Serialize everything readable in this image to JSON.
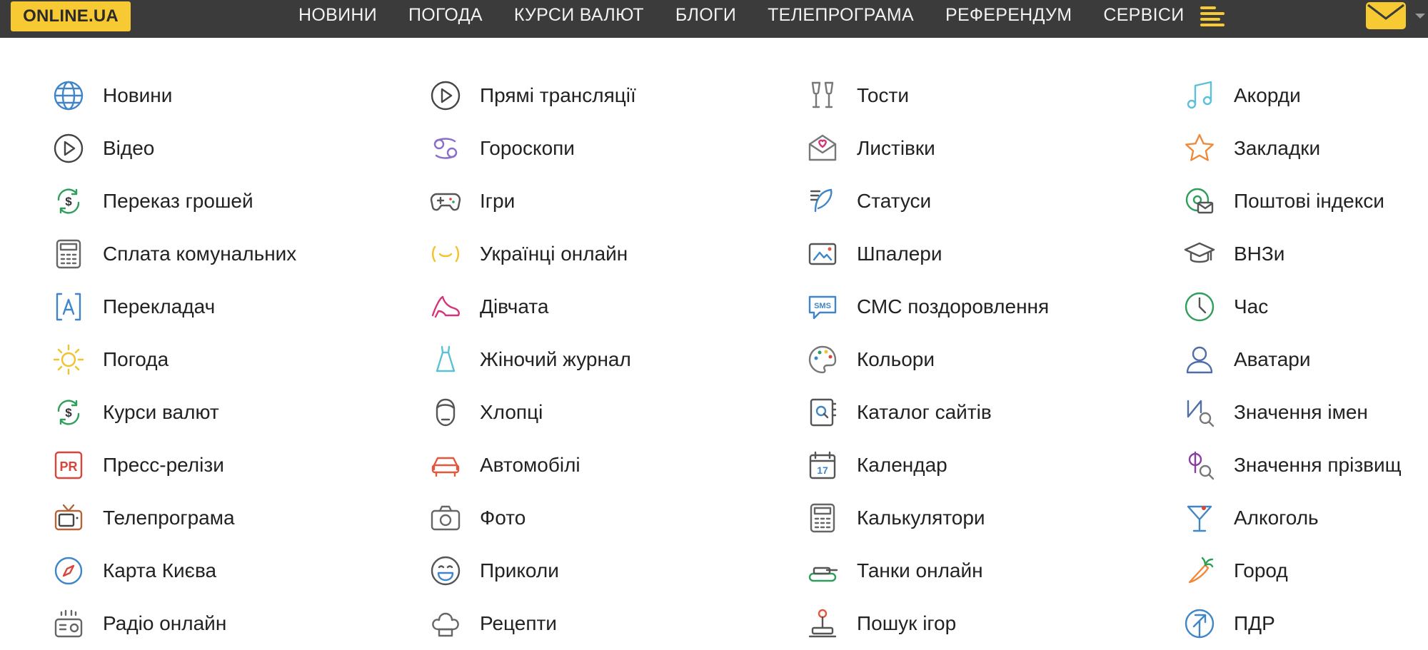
{
  "header": {
    "logo": "ONLINE.UA",
    "nav": [
      "НОВИНИ",
      "ПОГОДА",
      "КУРСИ ВАЛЮТ",
      "БЛОГИ",
      "ТЕЛЕПРОГРАМА",
      "РЕФЕРЕНДУМ",
      "СЕРВІСИ"
    ],
    "icons": {
      "menu": "menu-icon",
      "mail": "mail-icon"
    },
    "colors": {
      "bar": "#3b3b3b",
      "accent": "#f7c933"
    }
  },
  "columns": [
    [
      {
        "label": "Новини",
        "icon": "globe-icon"
      },
      {
        "label": "Відео",
        "icon": "play-icon"
      },
      {
        "label": "Переказ грошей",
        "icon": "money-transfer-icon"
      },
      {
        "label": "Сплата комунальних",
        "icon": "calculator-icon"
      },
      {
        "label": "Перекладач",
        "icon": "translate-icon"
      },
      {
        "label": "Погода",
        "icon": "sun-icon"
      },
      {
        "label": "Курси валют",
        "icon": "currency-icon"
      },
      {
        "label": "Пресс-релізи",
        "icon": "pr-icon"
      },
      {
        "label": "Телепрограма",
        "icon": "tv-icon"
      },
      {
        "label": "Карта Києва",
        "icon": "compass-icon"
      },
      {
        "label": "Радіо онлайн",
        "icon": "radio-icon"
      }
    ],
    [
      {
        "label": "Прямі трансляції",
        "icon": "play-icon"
      },
      {
        "label": "Гороскопи",
        "icon": "horoscope-icon"
      },
      {
        "label": "Ігри",
        "icon": "gamepad-icon"
      },
      {
        "label": "Українці онлайн",
        "icon": "smile-icon"
      },
      {
        "label": "Дівчата",
        "icon": "high-heel-icon"
      },
      {
        "label": "Жіночий журнал",
        "icon": "dress-icon"
      },
      {
        "label": "Хлопці",
        "icon": "man-face-icon"
      },
      {
        "label": "Автомобілі",
        "icon": "car-icon"
      },
      {
        "label": "Фото",
        "icon": "camera-icon"
      },
      {
        "label": "Приколи",
        "icon": "laugh-icon"
      },
      {
        "label": "Рецепти",
        "icon": "chef-hat-icon"
      }
    ],
    [
      {
        "label": "Тости",
        "icon": "glasses-icon"
      },
      {
        "label": "Листівки",
        "icon": "postcard-icon"
      },
      {
        "label": "Статуси",
        "icon": "feather-icon"
      },
      {
        "label": "Шпалери",
        "icon": "wallpaper-icon"
      },
      {
        "label": "СМС поздоровлення",
        "icon": "sms-icon"
      },
      {
        "label": "Кольори",
        "icon": "palette-icon"
      },
      {
        "label": "Каталог сайтів",
        "icon": "catalog-icon"
      },
      {
        "label": "Календар",
        "icon": "calendar-icon"
      },
      {
        "label": "Калькулятори",
        "icon": "calculator-icon"
      },
      {
        "label": "Танки онлайн",
        "icon": "tank-icon"
      },
      {
        "label": "Пошук ігор",
        "icon": "joystick-icon"
      }
    ],
    [
      {
        "label": "Акорди",
        "icon": "music-note-icon"
      },
      {
        "label": "Закладки",
        "icon": "star-icon"
      },
      {
        "label": "Поштові індекси",
        "icon": "postal-icon"
      },
      {
        "label": "ВНЗи",
        "icon": "graduation-cap-icon"
      },
      {
        "label": "Час",
        "icon": "clock-icon"
      },
      {
        "label": "Аватари",
        "icon": "avatar-icon"
      },
      {
        "label": "Значення імен",
        "icon": "name-search-icon"
      },
      {
        "label": "Значення прізвищ",
        "icon": "surname-search-icon"
      },
      {
        "label": "Алкоголь",
        "icon": "cocktail-icon"
      },
      {
        "label": "Город",
        "icon": "carrot-icon"
      },
      {
        "label": "ПДР",
        "icon": "road-sign-icon"
      }
    ]
  ]
}
